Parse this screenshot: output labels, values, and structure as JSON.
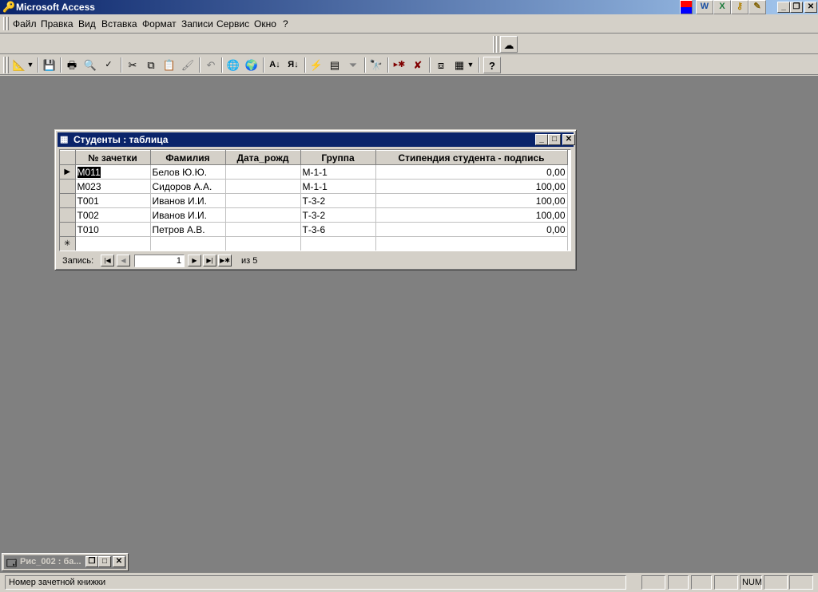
{
  "app": {
    "title": "Microsoft Access"
  },
  "menu": [
    "Файл",
    "Правка",
    "Вид",
    "Вставка",
    "Формат",
    "Записи",
    "Сервис",
    "Окно",
    "?"
  ],
  "datasheet": {
    "title": "Студенты : таблица",
    "columns": [
      "№ зачетки",
      "Фамилия",
      "Дата_рожд",
      "Группа",
      "Стипендия студента - подпись"
    ],
    "rows": [
      [
        "M011",
        "Белов Ю.Ю.",
        "",
        "М-1-1",
        "0,00"
      ],
      [
        "M023",
        "Сидоров А.А.",
        "",
        "М-1-1",
        "100,00"
      ],
      [
        "T001",
        "Иванов И.И.",
        "",
        "Т-3-2",
        "100,00"
      ],
      [
        "T002",
        "Иванов И.И.",
        "",
        "Т-3-2",
        "100,00"
      ],
      [
        "T010",
        "Петров А.В.",
        "",
        "Т-3-6",
        "0,00"
      ]
    ],
    "nav": {
      "label": "Запись:",
      "current": "1",
      "of_label": "из  5"
    }
  },
  "minimized_window": {
    "title": "Рис_002 : ба..."
  },
  "status": {
    "text": "Номер зачетной книжки",
    "num": "NUM"
  }
}
